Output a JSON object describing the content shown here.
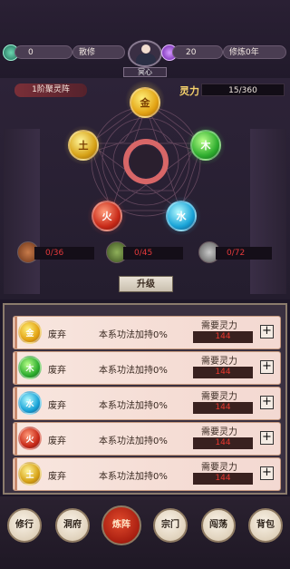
{
  "top": {
    "currency_value": "0",
    "rank": "散修",
    "gem_value": "20",
    "cultivation": "修炼0年",
    "center_tag": "冥心"
  },
  "arena": {
    "formation_level": "1阶聚灵阵",
    "lingli_label": "灵力",
    "lingli_value": "15/360",
    "lingli_fraction": 0.042,
    "orbs": {
      "metal": "金",
      "wood": "木",
      "water": "水",
      "fire": "火",
      "earth": "土"
    },
    "resources": [
      {
        "name": "copper-ore",
        "value": "0/36"
      },
      {
        "name": "herb",
        "value": "0/45"
      },
      {
        "name": "iron-ore",
        "value": "0/72"
      }
    ],
    "upgrade_label": "升级"
  },
  "rows": [
    {
      "element": "金",
      "color": "gold",
      "desc": "废弃",
      "bonus": "本系功法加持0%",
      "need_label": "需要灵力",
      "need_value": "144",
      "plus": "+"
    },
    {
      "element": "木",
      "color": "green",
      "desc": "废弃",
      "bonus": "本系功法加持0%",
      "need_label": "需要灵力",
      "need_value": "144",
      "plus": "+"
    },
    {
      "element": "水",
      "color": "blue",
      "desc": "废弃",
      "bonus": "本系功法加持0%",
      "need_label": "需要灵力",
      "need_value": "144",
      "plus": "+"
    },
    {
      "element": "火",
      "color": "red",
      "desc": "废弃",
      "bonus": "本系功法加持0%",
      "need_label": "需要灵力",
      "need_value": "144",
      "plus": "+"
    },
    {
      "element": "土",
      "color": "earth",
      "desc": "废弃",
      "bonus": "本系功法加持0%",
      "need_label": "需要灵力",
      "need_value": "144",
      "plus": "+"
    }
  ],
  "nav": {
    "items": [
      {
        "label": "修行",
        "active": false
      },
      {
        "label": "洞府",
        "active": false
      },
      {
        "label": "炼阵",
        "active": true
      },
      {
        "label": "宗门",
        "active": false
      },
      {
        "label": "闯荡",
        "active": false
      },
      {
        "label": "背包",
        "active": false
      }
    ]
  }
}
